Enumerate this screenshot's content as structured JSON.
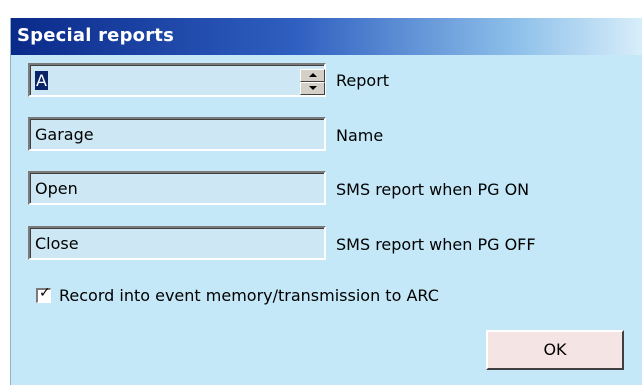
{
  "window": {
    "title": "Special reports"
  },
  "form": {
    "report": {
      "value": "A",
      "label": "Report"
    },
    "name": {
      "value": "Garage",
      "label": "Name"
    },
    "sms_on": {
      "value": "Open",
      "label": "SMS report when PG ON"
    },
    "sms_off": {
      "value": "Close",
      "label": "SMS report when PG OFF"
    },
    "record_checkbox": {
      "checked": true,
      "label": "Record into event memory/transmission to ARC"
    }
  },
  "buttons": {
    "ok_label": "OK"
  }
}
